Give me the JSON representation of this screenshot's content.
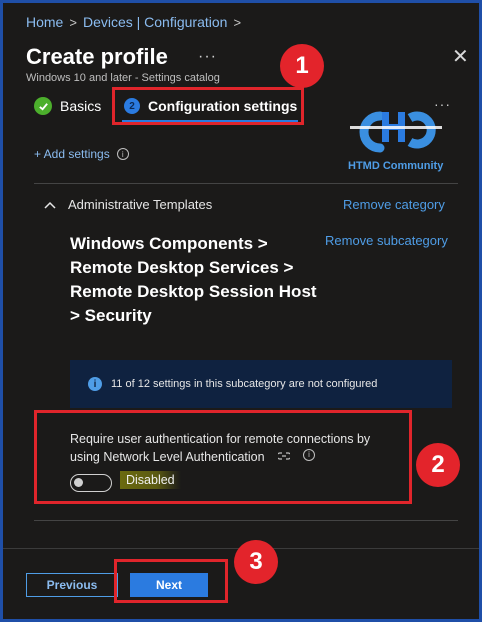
{
  "breadcrumb": {
    "items": [
      "Home",
      "Devices | Configuration"
    ],
    "separator": ">"
  },
  "header": {
    "title": "Create profile",
    "more": "···",
    "subtitle": "Windows 10 and later - Settings catalog",
    "close": "✕"
  },
  "steps": [
    {
      "label": "Basics",
      "status": "complete"
    },
    {
      "label": "Configuration settings",
      "number": "2",
      "status": "current"
    }
  ],
  "toolbar": {
    "add_settings": "+ Add settings"
  },
  "watermark": {
    "text": "HTMD Community",
    "more": "···"
  },
  "section": {
    "header": "Administrative Templates",
    "remove_category": "Remove category",
    "remove_subcategory": "Remove subcategory",
    "path": "Windows Components > Remote Desktop Services > Remote Desktop Session Host > Security"
  },
  "info_bar": {
    "icon": "i",
    "text": "11 of 12 settings in this subcategory are not configured"
  },
  "setting": {
    "label": "Require user authentication for remote connections by using Network Level Authentication",
    "toggle_state": "off",
    "toggle_label": "Disabled"
  },
  "footer": {
    "previous": "Previous",
    "next": "Next"
  },
  "annotations": [
    "1",
    "2",
    "3"
  ],
  "colors": {
    "accent": "#2b7be0",
    "link": "#4f9de6",
    "annotation": "#e3242b",
    "background": "#1b1a19",
    "success": "#4caf2c"
  }
}
